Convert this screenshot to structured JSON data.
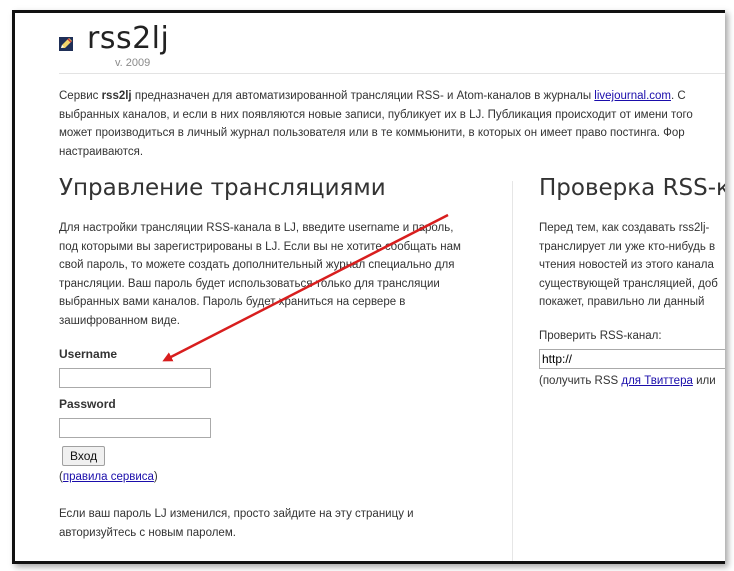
{
  "header": {
    "title": "rss2lj",
    "version": "v. 2009"
  },
  "intro": {
    "lines": [
      [
        "Сервис ",
        "rss2lj",
        " предназначен для автоматизированной трансляции RSS- и Atom-каналов в журналы ",
        "livejournal.com",
        ". С"
      ],
      "выбранных каналов, и если в них появляются новые записи, публикует их в LJ. Публикация происходит от имени того",
      "может производиться в личный журнал пользователя или в те коммьюнити, в которых он имеет право постинга. Фор",
      "настраиваются."
    ]
  },
  "left": {
    "heading": "Управление трансляциями",
    "para_lines": [
      "Для настройки трансляции RSS-канала в LJ, введите username и пароль,",
      "под которыми вы зарегистрированы в LJ. Если вы не хотите сообщать нам",
      "свой пароль, то можете создать дополнительный журнал специально для",
      "трансляции. Ваш пароль будет использоваться только для трансляции",
      "выбранных вами каналов. Пароль будет храниться на сервере в",
      "зашифрованном виде."
    ],
    "username_label": "Username",
    "username_value": "",
    "password_label": "Password",
    "password_value": "",
    "login_button": "Вход",
    "rules_open": "(",
    "rules_link": "правила сервиса",
    "rules_close": ")",
    "footer_lines": [
      "Если ваш пароль LJ изменился, просто зайдите на эту страницу и",
      "авторизуйтесь с новым паролем."
    ]
  },
  "right": {
    "heading": "Проверка RSS-ка",
    "para_lines": [
      "Перед тем, как создавать rss2lj-",
      "транслирует ли уже кто-нибудь в",
      "чтения новостей из этого канала",
      "существующей трансляцией, доб",
      "покажет, правильно ли данный"
    ],
    "check_label": "Проверить RSS-канал:",
    "url_value": "http://",
    "hint_prefix": "(получить RSS ",
    "hint_link": "для Твиттера",
    "hint_suffix": " или"
  },
  "colors": {
    "arrow": "#d81e1e",
    "link": "#1a0dab"
  }
}
